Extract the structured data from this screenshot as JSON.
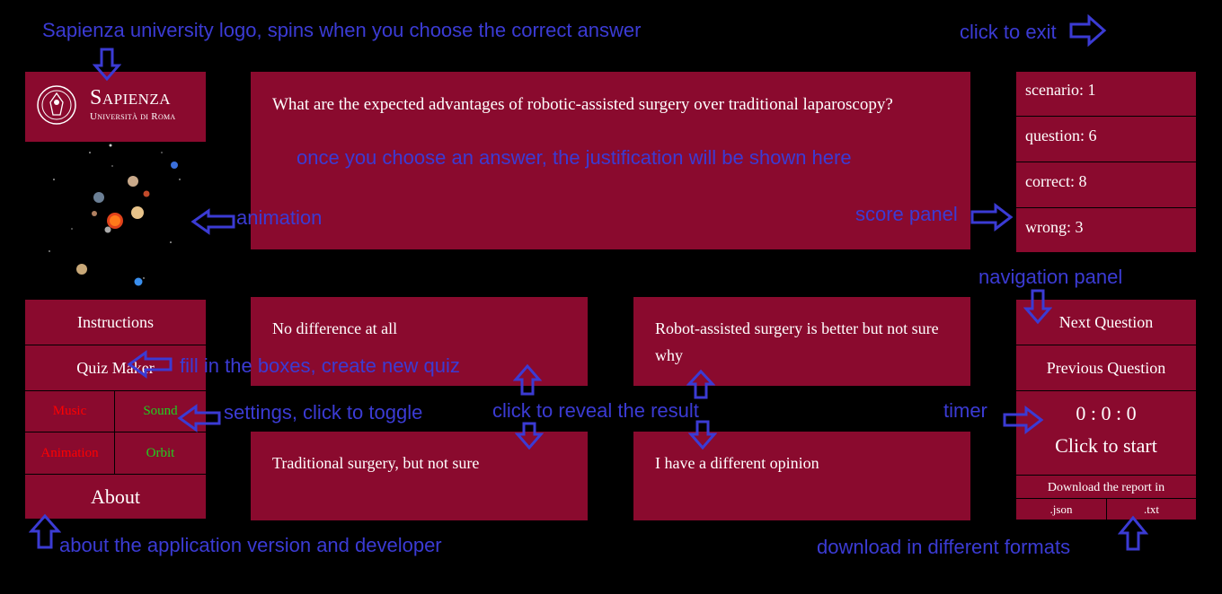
{
  "question": {
    "text": "What are the expected advantages of robotic-assisted surgery over traditional laparoscopy?"
  },
  "answers": [
    "No difference at all",
    "Robot-assisted surgery is better but not sure why",
    "Traditional surgery, but not sure",
    "I have a different opinion"
  ],
  "logo": {
    "title": "Sapienza",
    "subtitle": "Università di Roma"
  },
  "score": {
    "scenario": "scenario: 1",
    "question": "question: 6",
    "correct": "correct: 8",
    "wrong": "wrong: 3"
  },
  "menu": {
    "instructions": "Instructions",
    "quiz_maker": "Quiz Maker",
    "music": "Music",
    "sound": "Sound",
    "animation": "Animation",
    "orbit": "Orbit",
    "about": "About"
  },
  "settings_colors": {
    "off": "#ff0000",
    "on": "#1fd11f"
  },
  "navigation": {
    "next": "Next Question",
    "previous": "Previous Question"
  },
  "timer": {
    "time": "0 : 0 : 0",
    "start": "Click to start"
  },
  "download": {
    "label": "Download the report in",
    "json": ".json",
    "txt": ".txt"
  },
  "annotations": {
    "logo": "Sapienza university logo, spins when you choose the correct answer",
    "exit": "click to exit",
    "justification": "once you choose an answer, the justification will be shown here",
    "animation": "animation",
    "score_panel": "score panel",
    "navigation_panel": "navigation panel",
    "quiz_maker": "fill in the boxes, create new quiz",
    "settings": "settings, click to toggle",
    "reveal": "click to reveal the result",
    "timer": "timer",
    "about": "about the application version and developer",
    "download": "download in different formats"
  },
  "colors": {
    "panel": "#8a0a2e",
    "annotation": "#3b3bd4",
    "background": "#000000"
  }
}
